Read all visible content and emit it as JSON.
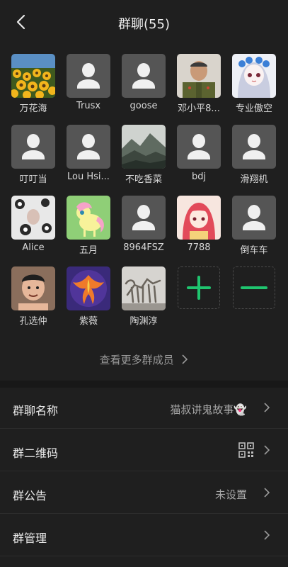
{
  "header": {
    "title": "群聊(55)"
  },
  "members": [
    {
      "name": "万花海",
      "avatar": "sunflower-photo"
    },
    {
      "name": "Trusx",
      "avatar": "default-avatar-icon"
    },
    {
      "name": "goose",
      "avatar": "default-avatar-icon"
    },
    {
      "name": "邓小平8...",
      "avatar": "soldier-photo"
    },
    {
      "name": "专业傲空",
      "avatar": "anime-girl-photo"
    },
    {
      "name": "叮叮当",
      "avatar": "default-avatar-icon"
    },
    {
      "name": "Lou Hsi...",
      "avatar": "default-avatar-icon"
    },
    {
      "name": "不吃香菜",
      "avatar": "mountain-photo"
    },
    {
      "name": "bdj",
      "avatar": "default-avatar-icon"
    },
    {
      "name": "滑翔机",
      "avatar": "default-avatar-icon"
    },
    {
      "name": "Alice",
      "avatar": "floral-art-photo"
    },
    {
      "name": "五月",
      "avatar": "pony-photo"
    },
    {
      "name": "8964FSZ",
      "avatar": "default-avatar-icon"
    },
    {
      "name": "7788",
      "avatar": "red-hair-anime-photo"
    },
    {
      "name": "倒车车",
      "avatar": "default-avatar-icon"
    },
    {
      "name": "孔选仲",
      "avatar": "man-photo"
    },
    {
      "name": "紫薇",
      "avatar": "phoenix-emblem-photo"
    },
    {
      "name": "陶渊淳",
      "avatar": "skeleton-photo"
    }
  ],
  "actions": {
    "add": "plus-icon",
    "remove": "minus-icon"
  },
  "more_link": "查看更多群成员",
  "settings": [
    {
      "label": "群聊名称",
      "value": "猫叔讲鬼故事👻"
    },
    {
      "label": "群二维码",
      "value": ""
    },
    {
      "label": "群公告",
      "value": "未设置"
    },
    {
      "label": "群管理",
      "value": ""
    }
  ],
  "colors": {
    "background": "#1f1f1f",
    "accent": "#1fc56f",
    "default_avatar": "#555555"
  }
}
